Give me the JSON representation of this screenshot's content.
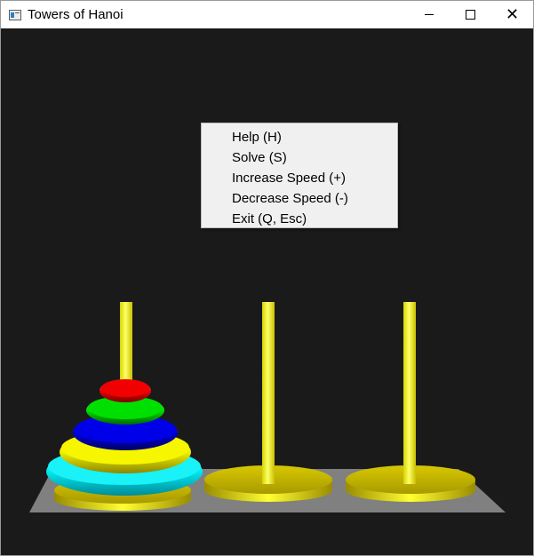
{
  "window": {
    "title": "Towers of Hanoi",
    "controls": {
      "minimize": "minimize-icon",
      "maximize": "maximize-icon",
      "close": "✕"
    }
  },
  "menu": {
    "items": [
      {
        "label": "Help (H)"
      },
      {
        "label": "Solve (S)"
      },
      {
        "label": "Increase Speed (+)"
      },
      {
        "label": "Decrease Speed (-)"
      },
      {
        "label": "Exit (Q, Esc)"
      }
    ]
  },
  "game": {
    "pegs": 3,
    "disks_on_peg": [
      5,
      0,
      0
    ],
    "disk_colors": [
      "#ff0000",
      "#00dd00",
      "#0000dd",
      "#ffff00",
      "#00ffff"
    ],
    "peg_color": "#ffff00",
    "board_color": "#808080",
    "background_color": "#1a1a1a"
  }
}
